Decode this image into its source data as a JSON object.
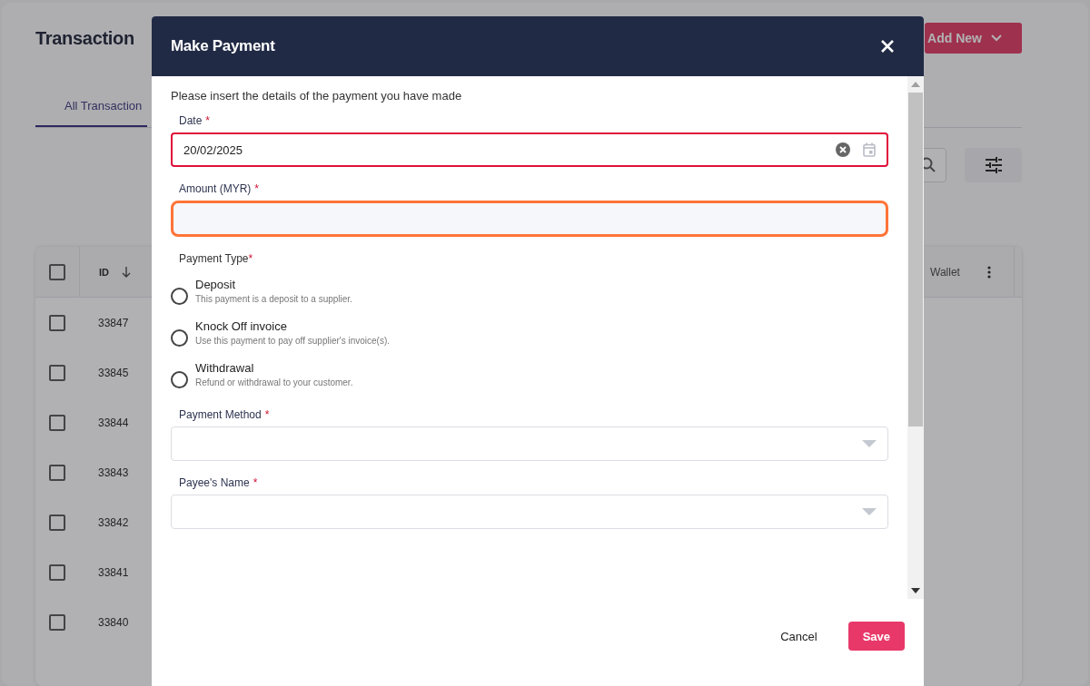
{
  "page": {
    "title": "Transaction",
    "tabs": [
      {
        "label": "All Transaction",
        "selected": true
      }
    ],
    "add_new_button": "Add New",
    "table": {
      "header_checked": false,
      "columns": [
        "ID",
        "Wallet"
      ],
      "rows": [
        {
          "id": "33847",
          "checked": false
        },
        {
          "id": "33845",
          "checked": false
        },
        {
          "id": "33844",
          "checked": false
        },
        {
          "id": "33843",
          "checked": false
        },
        {
          "id": "33842",
          "checked": false
        },
        {
          "id": "33841",
          "checked": false
        },
        {
          "id": "33840",
          "checked": false
        }
      ]
    }
  },
  "dialog": {
    "title": "Make Payment",
    "intro": "Please insert the details of the payment you have made",
    "fields": [
      {
        "kind": "date",
        "label": "Date",
        "required_mark": "*",
        "value": "20/02/2025",
        "invalid": true,
        "highlighted": false
      },
      {
        "kind": "text",
        "label": "Amount (MYR)",
        "required_mark": "*",
        "invalid": false,
        "highlighted": true
      },
      {
        "kind": "radio",
        "label": "Payment Type",
        "required_mark": "*",
        "options": [
          {
            "label": "Deposit",
            "description": "This payment is a deposit to a supplier.",
            "selected": false
          },
          {
            "label": "Knock Off invoice",
            "description": "Use this payment to pay off supplier's invoice(s).",
            "selected": false
          },
          {
            "label": "Withdrawal",
            "description": "Refund or withdrawal to your customer.",
            "selected": false
          }
        ]
      },
      {
        "kind": "select",
        "label": "Payment Method",
        "required_mark": "*",
        "invalid": false,
        "highlighted": false
      },
      {
        "kind": "select",
        "label": "Payee's Name",
        "required_mark": "*",
        "invalid": false,
        "highlighted": false
      }
    ],
    "buttons": [
      {
        "kind": "cancel",
        "label": "Cancel"
      },
      {
        "kind": "save",
        "label": "Save"
      }
    ]
  }
}
